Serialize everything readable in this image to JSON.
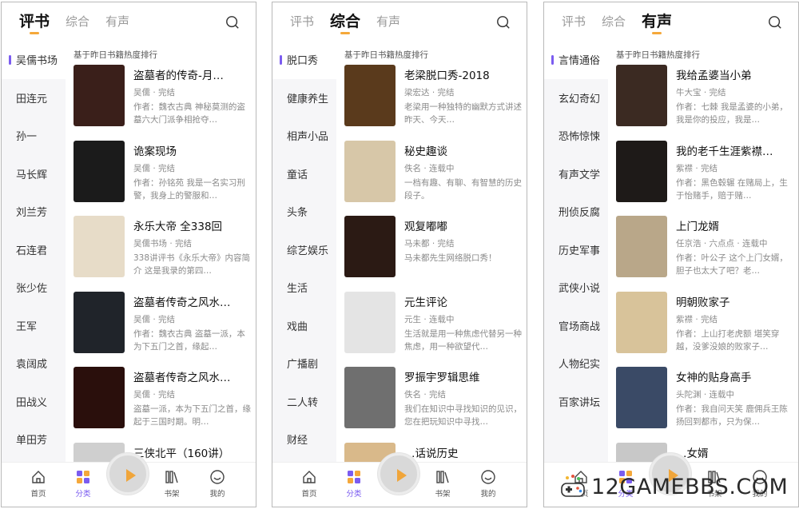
{
  "panels": [
    {
      "tabs": [
        "评书",
        "综合",
        "有声"
      ],
      "active_tab": 0,
      "subtitle": "基于昨日书籍热度排行",
      "categories": [
        "吴儒书场",
        "田连元",
        "孙一",
        "马长辉",
        "刘兰芳",
        "石连君",
        "张少佐",
        "王军",
        "袁阔成",
        "田战义",
        "单田芳"
      ],
      "books": [
        {
          "title": "盗墓者的传奇-月…",
          "meta": "吴儒 · 完结",
          "desc": "作者：魏衣古典 神秘莫测的盗墓六大门派争相抢夺…",
          "cover": "#3a1f1a"
        },
        {
          "title": "诡案现场",
          "meta": "吴儒 · 完结",
          "desc": "作者：孙铭苑 我是一名实习刑警，我身上的警服和…",
          "cover": "#1b1b1b"
        },
        {
          "title": "永乐大帝 全338回",
          "meta": "吴儒书场 · 完结",
          "desc": "338讲评书《永乐大帝》内容简介 这是我录的第四…",
          "cover": "#e7dcc8"
        },
        {
          "title": "盗墓者传奇之风水…",
          "meta": "吴儒 · 完结",
          "desc": "作者：魏衣古典 盗墓一派，本为下五门之首，缘起…",
          "cover": "#20242a"
        },
        {
          "title": "盗墓者传奇之风水…",
          "meta": "吴儒 · 完结",
          "desc": "盗墓一派，本为下五门之首，缘起于三国时期。明…",
          "cover": "#2a0f0c"
        },
        {
          "title": "三侠北平（160讲）",
          "meta": "",
          "desc": "",
          "cover": "#cfcfcf"
        }
      ],
      "nav": [
        "首页",
        "分类",
        "书架",
        "我的"
      ]
    },
    {
      "tabs": [
        "评书",
        "综合",
        "有声"
      ],
      "active_tab": 1,
      "subtitle": "基于昨日书籍热度排行",
      "categories": [
        "脱口秀",
        "健康养生",
        "相声小品",
        "童话",
        "头条",
        "综艺娱乐",
        "生活",
        "戏曲",
        "广播剧",
        "二人转",
        "财经"
      ],
      "books": [
        {
          "title": "老梁脱口秀-2018",
          "meta": "梁宏达 · 完结",
          "desc": "老梁用一种独特的幽默方式讲述昨天、今天…",
          "cover": "#5a3a1c"
        },
        {
          "title": "秘史趣谈",
          "meta": "佚名 · 连载中",
          "desc": "一档有趣、有聊、有智慧的历史段子。",
          "cover": "#d7c7a8"
        },
        {
          "title": "观复嘟嘟",
          "meta": "马未都 · 完结",
          "desc": "马未都先生网络脱口秀！",
          "cover": "#2b1a14"
        },
        {
          "title": "元生评论",
          "meta": "元生 · 连载中",
          "desc": "生活就是用一种焦虑代替另一种焦虑，用一种欲望代…",
          "cover": "#e4e4e4"
        },
        {
          "title": "罗振宇罗辑思维",
          "meta": "佚名 · 完结",
          "desc": "我们在知识中寻找知识的见识，您在把玩知识中寻找…",
          "cover": "#6f6f6f"
        },
        {
          "title": "…话说历史",
          "meta": "",
          "desc": "",
          "cover": "#d9b98a"
        }
      ],
      "nav": [
        "首页",
        "分类",
        "书架",
        "我的"
      ]
    },
    {
      "tabs": [
        "评书",
        "综合",
        "有声"
      ],
      "active_tab": 2,
      "subtitle": "基于昨日书籍热度排行",
      "categories": [
        "言情通俗",
        "玄幻奇幻",
        "恐怖惊悚",
        "有声文学",
        "刑侦反腐",
        "历史军事",
        "武侠小说",
        "官场商战",
        "人物纪实",
        "百家讲坛"
      ],
      "books": [
        {
          "title": "我给孟婆当小弟",
          "meta": "牛大宝 · 完结",
          "desc": "作者：七棘 我是孟婆的小弟，我是你的投应，我是…",
          "cover": "#3b2a22"
        },
        {
          "title": "我的老千生涯紫襟…",
          "meta": "紫襟 · 完结",
          "desc": "作者：黑色毂辗 在赌局上，生于怡赌手，赔于赌…",
          "cover": "#1e1a18"
        },
        {
          "title": "上门龙婿",
          "meta": "任京浩 · 六点点 · 连载中",
          "desc": "作者：叶公子 这个上门女婿，胆子也太大了吧？老…",
          "cover": "#b9a789"
        },
        {
          "title": "明朝败家子",
          "meta": "紫襟 · 完结",
          "desc": "作者：上山打老虎额 堪笑穿越，没爹没娘的败家子…",
          "cover": "#d8c39a"
        },
        {
          "title": "女神的贴身高手",
          "meta": "头陀渊 · 连载中",
          "desc": "作者：我自问天笑 鹿佣兵王陈扬回到都市，只为保…",
          "cover": "#3a4a66"
        },
        {
          "title": "…女婿",
          "meta": "",
          "desc": "",
          "cover": "#c8c8c8"
        }
      ],
      "nav": [
        "首页",
        "分类",
        "书架",
        "我的"
      ]
    }
  ],
  "watermark": {
    "text": "12GAMEBBS.COM"
  },
  "colors": {
    "accent": "#7b5cf0",
    "tab_underline": "#f5a83a",
    "play": "#f0a53a"
  }
}
